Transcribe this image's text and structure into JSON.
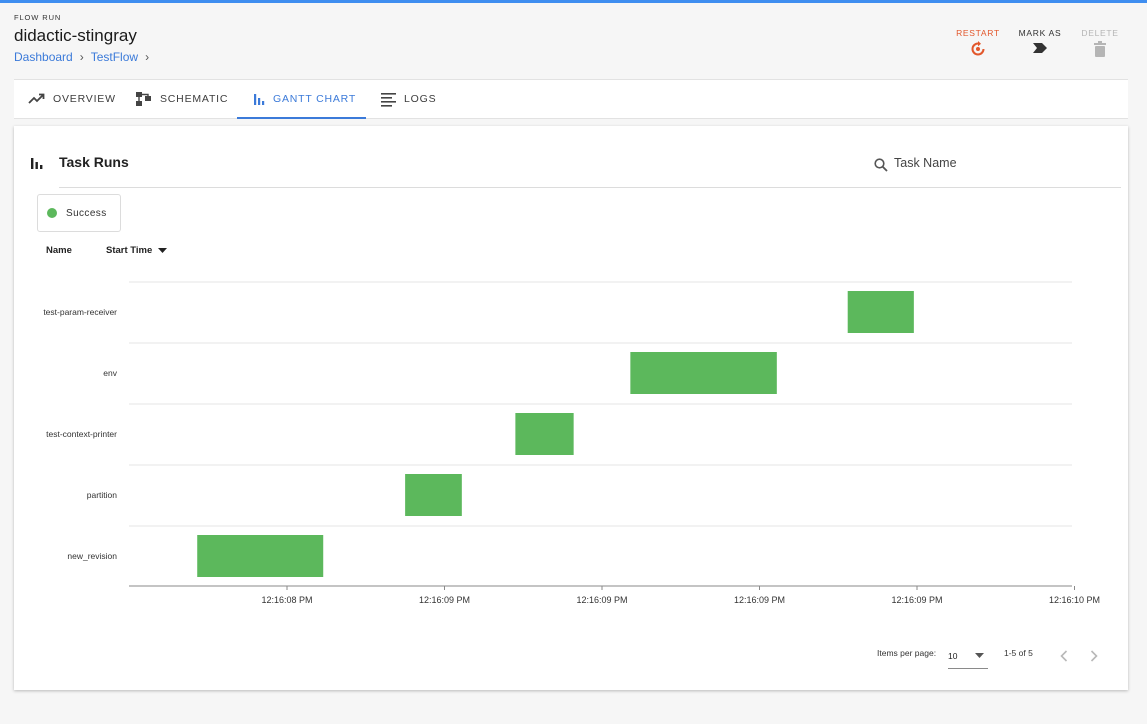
{
  "header": {
    "eyebrow": "FLOW RUN",
    "title": "didactic-stingray",
    "breadcrumbs": [
      "Dashboard",
      "TestFlow"
    ]
  },
  "actions": {
    "restart": "RESTART",
    "mark_as": "MARK AS",
    "delete": "DELETE"
  },
  "tabs": [
    {
      "label": "OVERVIEW",
      "icon": "trending-up-icon"
    },
    {
      "label": "SCHEMATIC",
      "icon": "schematic-icon"
    },
    {
      "label": "GANTT CHART",
      "icon": "bar-chart-icon",
      "active": true
    },
    {
      "label": "LOGS",
      "icon": "logs-icon"
    }
  ],
  "task_runs": {
    "title": "Task Runs",
    "search_placeholder": "Task Name",
    "legend": {
      "label": "Success",
      "color": "#5cb85c"
    },
    "columns": {
      "name": "Name",
      "start_time": "Start Time"
    }
  },
  "chart_data": {
    "type": "gantt",
    "rows": [
      "test-param-receiver",
      "env",
      "test-context-printer",
      "partition",
      "new_revision"
    ],
    "x_ticks": [
      "12:16:08 PM",
      "12:16:09 PM",
      "12:16:09 PM",
      "12:16:09 PM",
      "12:16:09 PM",
      "12:16:10 PM"
    ],
    "bars": [
      {
        "task": "test-param-receiver",
        "start": 3.56,
        "end": 3.98,
        "state": "Success"
      },
      {
        "task": "env",
        "start": 2.18,
        "end": 3.11,
        "state": "Success"
      },
      {
        "task": "test-context-printer",
        "start": 1.45,
        "end": 1.82,
        "state": "Success"
      },
      {
        "task": "partition",
        "start": 0.75,
        "end": 1.11,
        "state": "Success"
      },
      {
        "task": "new_revision",
        "start": -0.57,
        "end": 0.23,
        "state": "Success"
      }
    ],
    "bar_color": "#5cb85c"
  },
  "pagination": {
    "items_per_page_label": "Items per page:",
    "items_per_page": "10",
    "range": "1-5 of 5"
  }
}
